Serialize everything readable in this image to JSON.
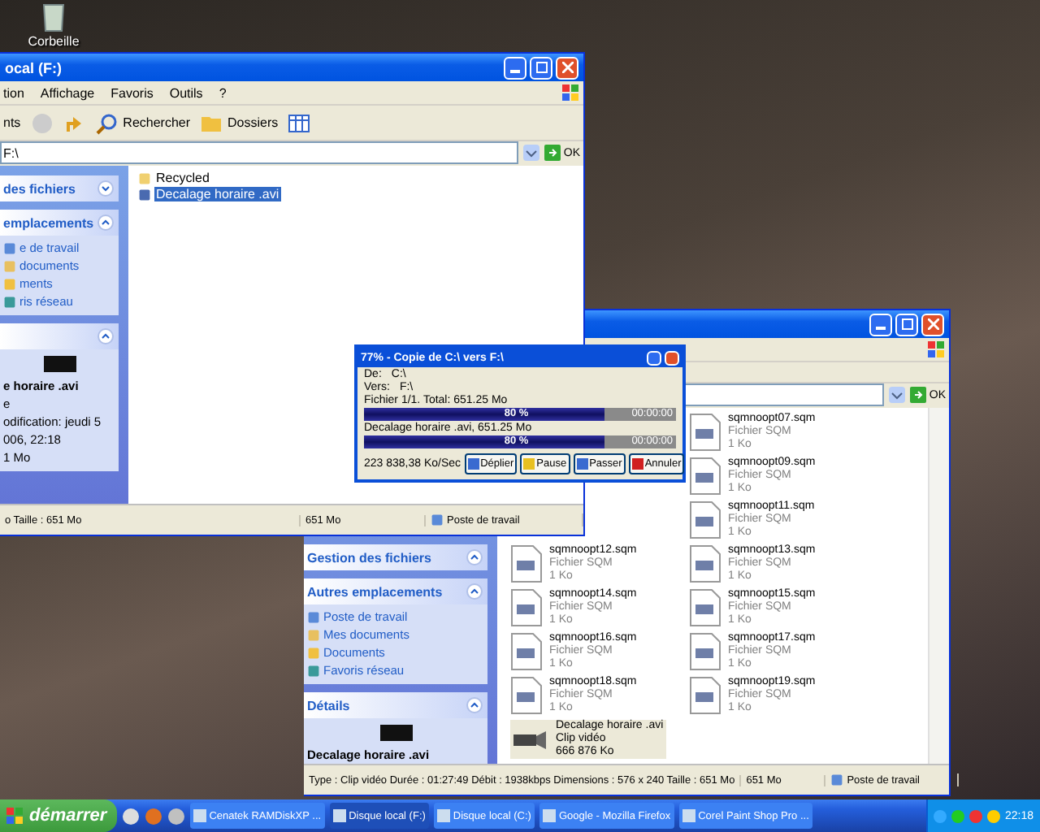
{
  "desktop": {
    "icons": [
      {
        "label": "Corbeille"
      }
    ]
  },
  "windows": [
    {
      "title": "ocal (F:)",
      "menu": [
        "tion",
        "Affichage",
        "Favoris",
        "Outils",
        "?"
      ],
      "toolbar": [
        {
          "kind": "text",
          "label": "nts"
        },
        {
          "kind": "back"
        },
        {
          "kind": "up"
        },
        {
          "kind": "search",
          "label": "Rechercher"
        },
        {
          "kind": "folders",
          "label": "Dossiers"
        },
        {
          "kind": "views"
        }
      ],
      "address": "F:\\",
      "go": "OK",
      "panels": [
        {
          "title": "des fichiers",
          "expanded": false
        },
        {
          "title": "emplacements",
          "expanded": true,
          "items": [
            "e de travail",
            "documents",
            "ments",
            "ris réseau"
          ]
        },
        {
          "kind": "details",
          "expanded": true,
          "name": "e horaire .avi",
          "lines": [
            "e",
            "odification: jeudi 5",
            "006, 22:18",
            "1 Mo"
          ]
        }
      ],
      "files": [
        {
          "name": "Recycled",
          "kind": "folder",
          "selected": false
        },
        {
          "name": "Decalage horaire .avi",
          "kind": "video",
          "selected": true
        }
      ],
      "status": [
        "o Taille : 651 Mo",
        "651 Mo",
        "Poste de travail"
      ]
    },
    {
      "go": "OK",
      "panels": [
        {
          "title": "Gestion des fichiers",
          "expanded": true
        },
        {
          "title": "Autres emplacements",
          "expanded": true,
          "items": [
            "Poste de travail",
            "Mes documents",
            "Documents",
            "Favoris réseau"
          ]
        },
        {
          "kind": "details",
          "title": "Détails",
          "expanded": true,
          "name": "Decalage horaire .avi"
        }
      ],
      "rows": [
        {
          "right": {
            "name": "sqmnoopt07.sqm",
            "type": "Fichier SQM",
            "size": "1 Ko"
          }
        },
        {
          "right": {
            "name": "sqmnoopt09.sqm",
            "type": "Fichier SQM",
            "size": "1 Ko"
          }
        },
        {
          "right": {
            "name": "sqmnoopt11.sqm",
            "type": "Fichier SQM",
            "size": "1 Ko"
          }
        },
        {
          "left": {
            "name": "sqmnoopt12.sqm",
            "type": "Fichier SQM",
            "size": "1 Ko"
          },
          "right": {
            "name": "sqmnoopt13.sqm",
            "type": "Fichier SQM",
            "size": "1 Ko"
          }
        },
        {
          "left": {
            "name": "sqmnoopt14.sqm",
            "type": "Fichier SQM",
            "size": "1 Ko"
          },
          "right": {
            "name": "sqmnoopt15.sqm",
            "type": "Fichier SQM",
            "size": "1 Ko"
          }
        },
        {
          "left": {
            "name": "sqmnoopt16.sqm",
            "type": "Fichier SQM",
            "size": "1 Ko"
          },
          "right": {
            "name": "sqmnoopt17.sqm",
            "type": "Fichier SQM",
            "size": "1 Ko"
          }
        },
        {
          "left": {
            "name": "sqmnoopt18.sqm",
            "type": "Fichier SQM",
            "size": "1 Ko"
          },
          "right": {
            "name": "sqmnoopt19.sqm",
            "type": "Fichier SQM",
            "size": "1 Ko"
          }
        },
        {
          "left": {
            "name": "Decalage horaire .avi",
            "type": "Clip vidéo",
            "size": "666 876 Ko",
            "kind": "video",
            "selected": true
          }
        }
      ],
      "status": [
        "Type : Clip vidéo Durée : 01:27:49 Débit : 1938kbps Dimensions : 576 x 240 Taille : 651 Mo",
        "651 Mo",
        "Poste de travail"
      ]
    }
  ],
  "copy_dialog": {
    "title": "77% - Copie de C:\\ vers F:\\",
    "from_label": "De:",
    "from": "C:\\",
    "to_label": "Vers:",
    "to": "F:\\",
    "bars": [
      {
        "caption": "Fichier 1/1. Total: 651.25 Mo",
        "level": 0.77,
        "percent": "80 %",
        "time": "00:00:00"
      },
      {
        "caption": "Decalage horaire .avi, 651.25 Mo",
        "level": 0.77,
        "percent": "80 %",
        "time": "00:00:00"
      }
    ],
    "speed": "223 838,38 Ko/Sec",
    "buttons": [
      {
        "kind": "expand",
        "label": "Déplier"
      },
      {
        "kind": "pause",
        "label": "Pause"
      },
      {
        "kind": "skip",
        "label": "Passer"
      },
      {
        "kind": "cancel",
        "label": "Annuler"
      }
    ]
  },
  "taskbar": {
    "start": "démarrer",
    "tasks": [
      {
        "label": "Cenatek RAMDiskXP ...",
        "selected": false
      },
      {
        "label": "Disque local (F:)",
        "selected": true
      },
      {
        "label": "Disque local (C:)",
        "selected": false
      },
      {
        "label": "Google - Mozilla Firefox",
        "selected": false
      },
      {
        "label": "Corel Paint Shop Pro ...",
        "selected": false
      }
    ],
    "clock": "22:18"
  }
}
